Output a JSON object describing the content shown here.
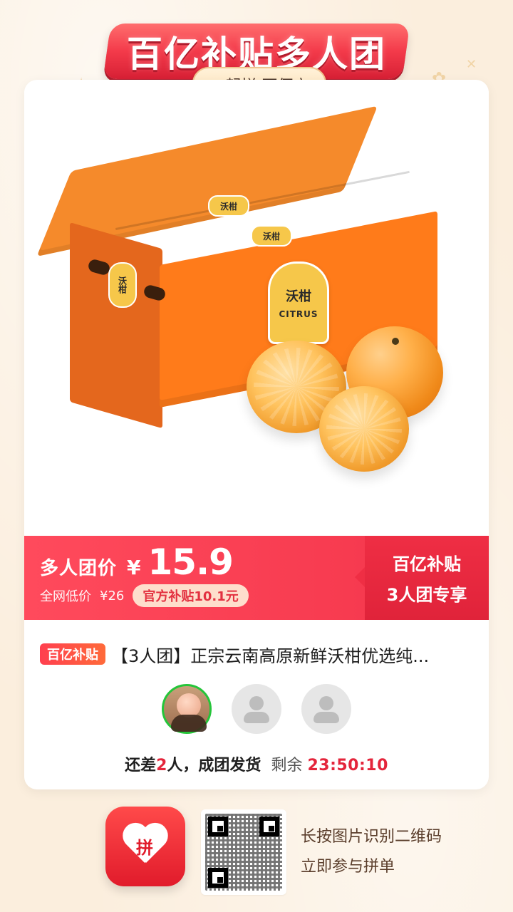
{
  "header": {
    "title": "百亿补贴多人团",
    "subtitle": "一起拼 更便宜"
  },
  "product": {
    "image_alt": "Citrus box and oranges",
    "box_labels": {
      "brand_cn": "沃柑",
      "brand_en": "CITRUS"
    }
  },
  "price": {
    "group_label": "多人团价",
    "currency": "¥",
    "value": "15.9",
    "market_label": "全网低价",
    "market_price": "¥26",
    "subsidy_label": "官方补贴10.1元",
    "right_line1": "百亿补贴",
    "right_line2": "3人团专享"
  },
  "title_row": {
    "badge": "百亿补贴",
    "title": "【3人团】正宗云南高原新鲜沃柑优选纯..."
  },
  "group_status": {
    "remaining_prefix": "还差",
    "remaining_count": "2",
    "remaining_suffix": "人，成团发货",
    "time_label": "剩余",
    "time_left": "23:50:10"
  },
  "footer": {
    "line1": "长按图片识别二维码",
    "line2": "立即参与拼单"
  },
  "colors": {
    "accent_red": "#F73B50",
    "bg_cream": "#FBEEDD",
    "success_green": "#25C53A"
  },
  "icons": {
    "avatar_placeholder": "user-icon",
    "app_icon": "pinduoduo-app-icon",
    "qr": "qr-code-icon"
  }
}
